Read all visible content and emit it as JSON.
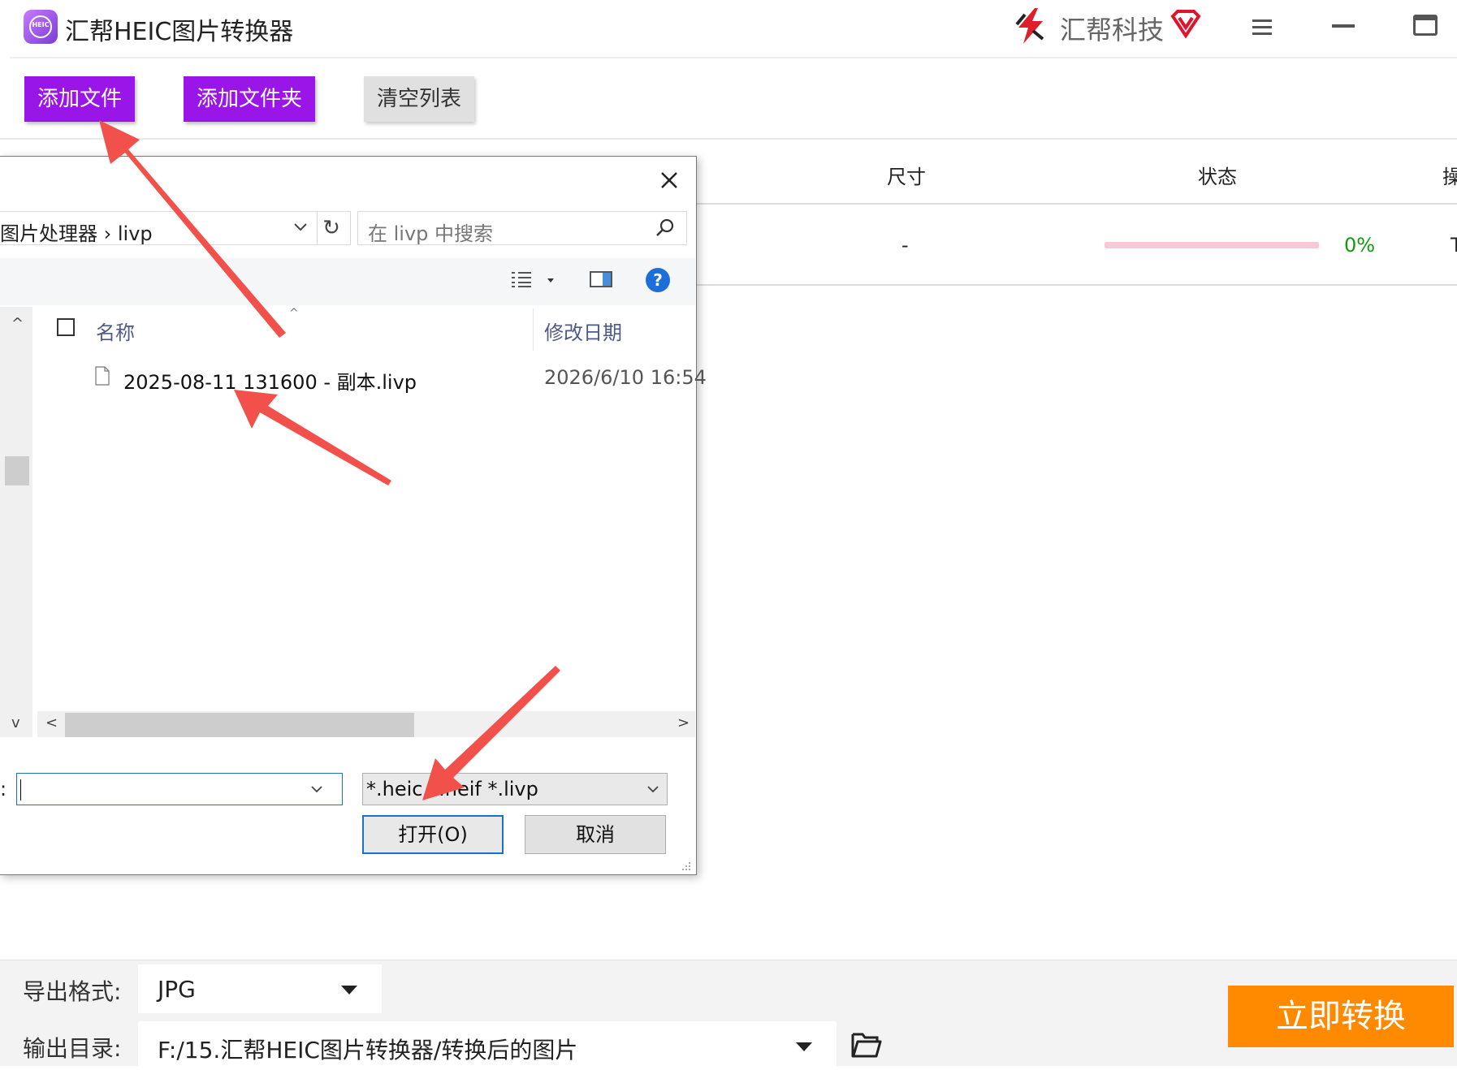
{
  "app": {
    "title": "汇帮HEIC图片转换器",
    "logo_text": "HEIC",
    "brand": "汇帮科技"
  },
  "toolbar": {
    "add_file_label": "添加文件",
    "add_folder_label": "添加文件夹",
    "clear_label": "清空列表"
  },
  "table": {
    "headers": {
      "size": "尺寸",
      "status": "状态",
      "op": "操"
    },
    "rows": [
      {
        "size": "-",
        "progress": 0,
        "progress_text": "0%",
        "op": "T"
      }
    ]
  },
  "dialog": {
    "address_path": "图片处理器 › livp",
    "refresh_glyph": "↻",
    "search_placeholder": "在 livp 中搜索",
    "help_glyph": "?",
    "columns": {
      "name": "名称",
      "date": "修改日期",
      "sort_glyph": "^"
    },
    "files": [
      {
        "name": "2025-08-11 131600 - 副本.livp",
        "date": "2026/6/10 16:54"
      }
    ],
    "filename_label_tail": ":",
    "filename_value": "",
    "filter_value": "*.heic *.heif *.livp",
    "open_label": "打开(O)",
    "cancel_label": "取消",
    "scroll_glyphs": {
      "up": "^",
      "down": "v",
      "left": "<",
      "right": ">"
    }
  },
  "bottom": {
    "format_label": "导出格式:",
    "format_value": "JPG",
    "dir_label": "输出目录:",
    "dir_value": "F:/15.汇帮HEIC图片转换器/转换后的图片",
    "convert_label": "立即转换"
  },
  "colors": {
    "accent_purple": "#9a16e8",
    "convert_orange": "#ff8a00",
    "progress_track": "#f8c8d6",
    "percent_green": "#119911",
    "arrow_red": "#f2504b",
    "dialog_focus_blue": "#1a72c8"
  },
  "icons": [
    "app-logo-icon",
    "brand-logo-icon",
    "vip-icon",
    "menu-icon",
    "minimize-icon",
    "maximize-icon",
    "close-icon",
    "chevron-down-icon",
    "refresh-icon",
    "search-icon",
    "view-list-icon",
    "preview-pane-icon",
    "help-icon",
    "file-icon",
    "folder-open-icon",
    "resize-grip-icon"
  ]
}
